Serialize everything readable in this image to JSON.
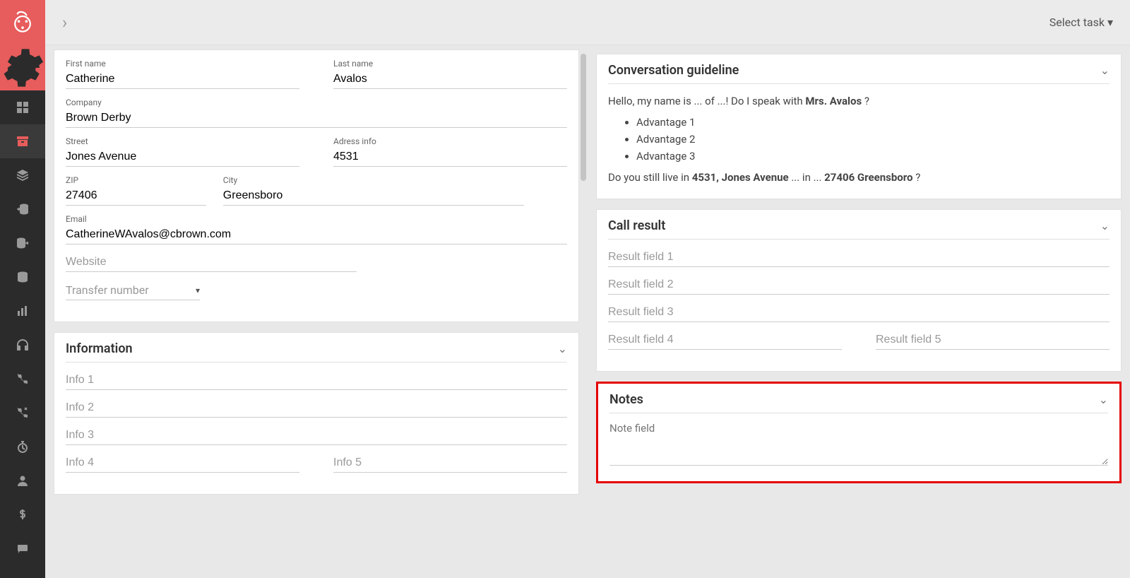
{
  "topbar": {
    "select_task": "Select task"
  },
  "contact": {
    "first_name_label": "First name",
    "first_name": "Catherine",
    "last_name_label": "Last name",
    "last_name": "Avalos",
    "company_label": "Company",
    "company": "Brown Derby",
    "street_label": "Street",
    "street": "Jones Avenue",
    "address_info_label": "Adress info",
    "address_info": "4531",
    "zip_label": "ZIP",
    "zip": "27406",
    "city_label": "City",
    "city": "Greensboro",
    "email_label": "Email",
    "email": "CatherineWAvalos@cbrown.com",
    "website_placeholder": "Website",
    "transfer_number_placeholder": "Transfer number"
  },
  "information": {
    "title": "Information",
    "info1": "Info 1",
    "info2": "Info 2",
    "info3": "Info 3",
    "info4": "Info 4",
    "info5": "Info 5"
  },
  "guideline": {
    "title": "Conversation guideline",
    "hello_prefix": "Hello, my name is ... of ...! Do I speak with ",
    "salutation": "Mrs. Avalos",
    "hello_suffix": " ?",
    "adv1": "Advantage 1",
    "adv2": "Advantage 2",
    "adv3": "Advantage 3",
    "live_prefix": "Do you still live in ",
    "address_bold1": "4531, Jones Avenue",
    "live_mid": " ... in ... ",
    "address_bold2": "27406 Greensboro",
    "live_suffix": " ?"
  },
  "call_result": {
    "title": "Call result",
    "r1": "Result field 1",
    "r2": "Result field 2",
    "r3": "Result field 3",
    "r4": "Result field 4",
    "r5": "Result field 5"
  },
  "notes": {
    "title": "Notes",
    "placeholder": "Note field"
  }
}
